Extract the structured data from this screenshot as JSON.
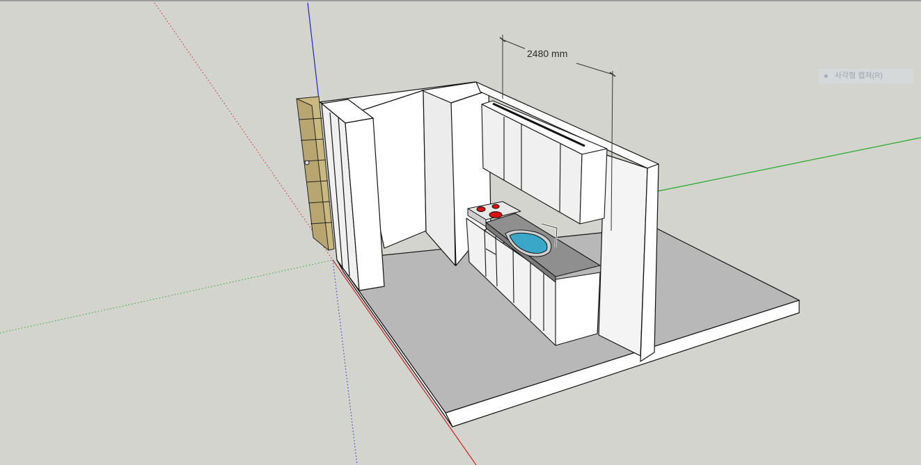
{
  "scene": {
    "dimension_label": "2480 mm"
  },
  "overlay": {
    "capture_hint": "사각형 캡쳐(R)"
  },
  "colors": {
    "background": "#d4d4cf",
    "axis_red": "#cc2222",
    "axis_green": "#22aa22",
    "axis_blue": "#2222cc",
    "wall_face": "#ffffff",
    "wall_shade": "#e4e4e4",
    "floor_top": "#b8b8b8",
    "shelf_wood": "#c9b880",
    "sink_water": "#3aa6c8",
    "cooktop_burner": "#dd1111",
    "countertop": "#8f8f8f"
  }
}
